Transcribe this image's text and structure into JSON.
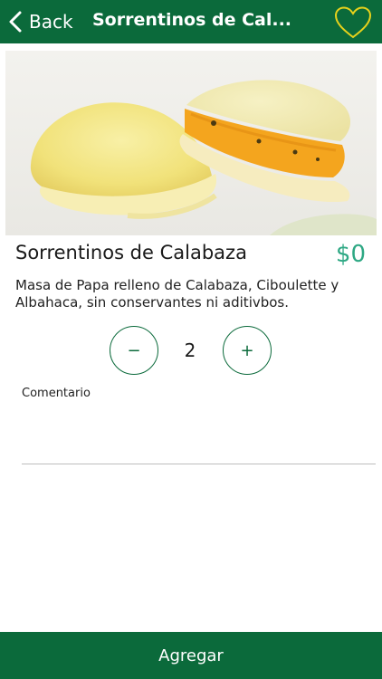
{
  "nav": {
    "back_label": "Back",
    "title": "Sorrentinos de Cal...",
    "favorite_icon": "heart-outline-icon",
    "back_icon": "chevron-left-icon"
  },
  "product": {
    "name": "Sorrentinos de Calabaza",
    "price": "$0",
    "description": "Masa de Papa relleno de Calabaza, Ciboulette y Albahaca, sin conservantes ni aditivbos."
  },
  "stepper": {
    "minus": "−",
    "quantity": "2",
    "plus": "+"
  },
  "comment": {
    "label": "Comentario",
    "value": ""
  },
  "action": {
    "add_label": "Agregar"
  },
  "colors": {
    "primary": "#0b6a3b",
    "accent_price": "#2ea884",
    "heart": "#e8d21b"
  }
}
